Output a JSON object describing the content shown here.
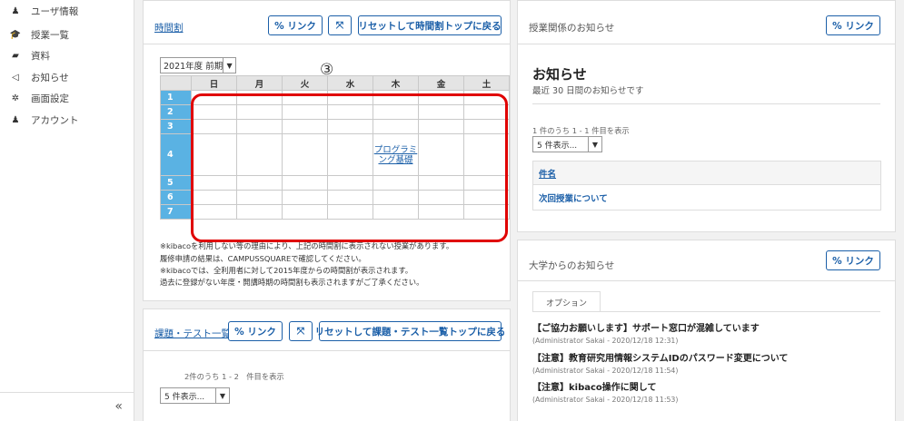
{
  "sidebar": {
    "items": [
      {
        "label": "ユーザ情報",
        "icon": "user-icon",
        "glyph": "♟"
      },
      {
        "label": "授業一覧",
        "icon": "graduation-icon",
        "glyph": "🎓"
      },
      {
        "label": "資料",
        "icon": "folder-icon",
        "glyph": "▰"
      },
      {
        "label": "お知らせ",
        "icon": "megaphone-icon",
        "glyph": "◁"
      },
      {
        "label": "画面設定",
        "icon": "gear-icon",
        "glyph": "✲"
      },
      {
        "label": "アカウント",
        "icon": "user-icon",
        "glyph": "♟"
      }
    ],
    "collapse_label": "«"
  },
  "timetable_panel": {
    "title": "時間割",
    "link_label": "% リンク",
    "expand_label": "⤧",
    "reset_label": "リセットして時間割トップに戻る",
    "term": "2021年度 前期",
    "dropdown_glyph": "▼",
    "days": [
      "日",
      "月",
      "火",
      "水",
      "木",
      "金",
      "土"
    ],
    "periods": [
      "1",
      "2",
      "3",
      "4",
      "5",
      "6",
      "7"
    ],
    "course": {
      "period": "4",
      "day": "木",
      "name": "プログラミング基礎"
    },
    "marker": "③",
    "notes": [
      "※kibacoを利用しない等の理由により、上記の時間割に表示されない授業があります。",
      "履修申請の結果は、CAMPUSSQUAREで確認してください。",
      "※kibacoでは、全利用者に対して2015年度からの時間割が表示されます。",
      "過去に登録がない年度・開講時期の時間割も表示されますがご了承ください。"
    ]
  },
  "tasks_panel": {
    "title": "課題・テスト一覧",
    "link_label": "% リンク",
    "expand_label": "⤧",
    "reset_label": "リセットして課題・テスト一覧トップに戻る",
    "count_text": "2件のうち 1 - 2　件目を表示",
    "show_select": "5 件表示...",
    "dropdown_glyph": "▼"
  },
  "announcements_panel": {
    "title": "授業関係のお知らせ",
    "link_label": "% リンク",
    "heading": "お知らせ",
    "subheading": "最近 30 日間のお知らせです",
    "count_text": "1 件のうち 1 - 1 件目を表示",
    "show_select": "5 件表示...",
    "dropdown_glyph": "▼",
    "column_header": "件名",
    "rows": [
      "次回授業について"
    ]
  },
  "university_panel": {
    "title": "大学からのお知らせ",
    "link_label": "% リンク",
    "tab_label": "オプション",
    "items": [
      {
        "title": "【ご協力お願いします】サポート窓口が混雑しています",
        "meta": "(Administrator Sakai - 2020/12/18 12:31)"
      },
      {
        "title": "【注意】教育研究用情報システムIDのパスワード変更について",
        "meta": "(Administrator Sakai - 2020/12/18 11:54)"
      },
      {
        "title": "【注意】kibaco操作に関して",
        "meta": "(Administrator Sakai - 2020/12/18 11:53)"
      }
    ]
  }
}
